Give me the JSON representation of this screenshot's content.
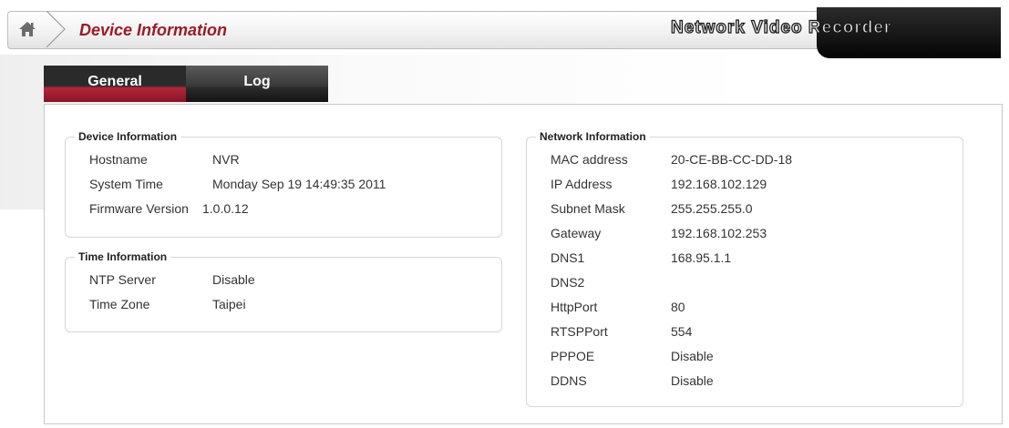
{
  "header": {
    "page_title": "Device Information",
    "brand": "Network Video Recorder"
  },
  "tabs": [
    {
      "label": "General",
      "active": true
    },
    {
      "label": "Log",
      "active": false
    }
  ],
  "device_info": {
    "legend": "Device Information",
    "rows": [
      {
        "label": "Hostname",
        "value": "NVR"
      },
      {
        "label": "System Time",
        "value": "Monday Sep 19 14:49:35 2011"
      },
      {
        "label": "Firmware Version",
        "value": "1.0.0.12"
      }
    ]
  },
  "time_info": {
    "legend": "Time Information",
    "rows": [
      {
        "label": "NTP Server",
        "value": "Disable"
      },
      {
        "label": "Time Zone",
        "value": "Taipei"
      }
    ]
  },
  "network_info": {
    "legend": "Network Information",
    "rows": [
      {
        "label": "MAC address",
        "value": "20-CE-BB-CC-DD-18"
      },
      {
        "label": "IP Address",
        "value": "192.168.102.129"
      },
      {
        "label": "Subnet Mask",
        "value": "255.255.255.0"
      },
      {
        "label": "Gateway",
        "value": "192.168.102.253"
      },
      {
        "label": "DNS1",
        "value": "168.95.1.1"
      },
      {
        "label": "DNS2",
        "value": ""
      },
      {
        "label": "HttpPort",
        "value": "80"
      },
      {
        "label": "RTSPPort",
        "value": "554"
      },
      {
        "label": "PPPOE",
        "value": "Disable"
      },
      {
        "label": "DDNS",
        "value": "Disable"
      }
    ]
  },
  "colors": {
    "accent": "#9a1b28",
    "tab_active": "#b0283a",
    "tab_dark": "#2a2a2a"
  },
  "icons": {
    "home": "home-icon",
    "breadcrumb": "chevron-right-icon"
  }
}
